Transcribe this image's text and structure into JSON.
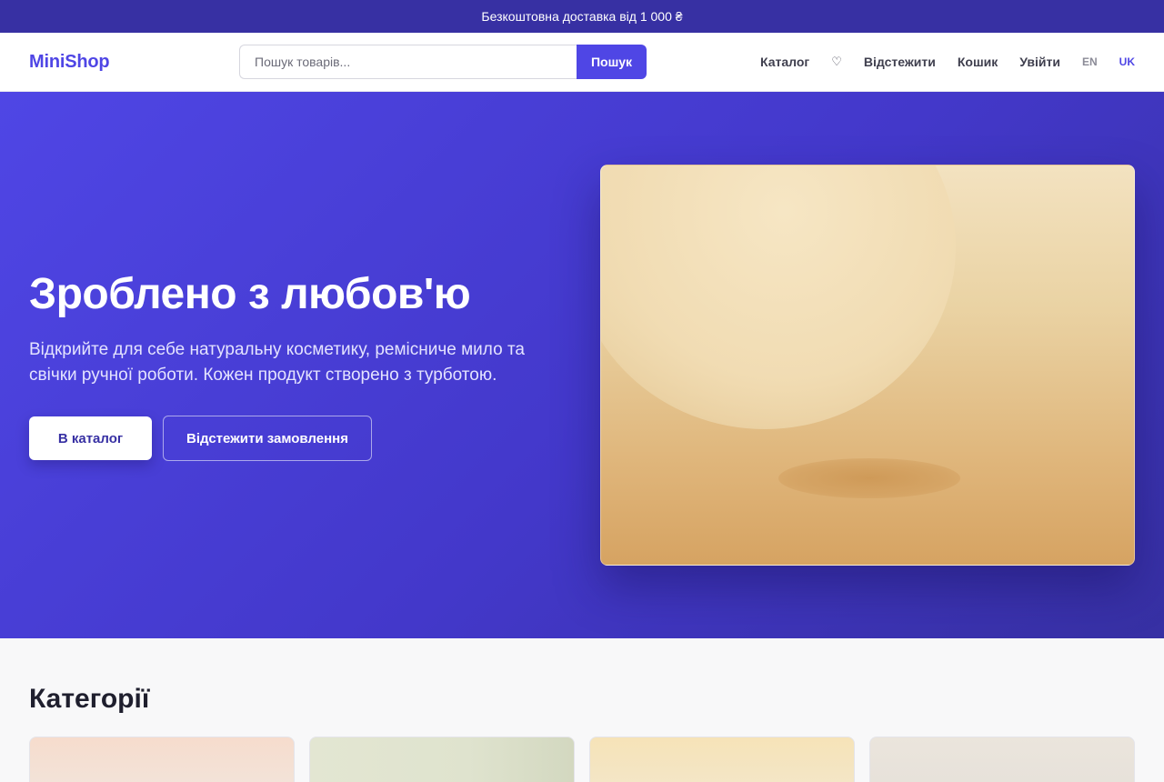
{
  "promo": {
    "text": "Безкоштовна доставка від 1 000 ₴"
  },
  "header": {
    "logo": "MiniShop",
    "search": {
      "placeholder": "Пошук товарів...",
      "value": "",
      "button_label": "Пошук"
    },
    "nav": {
      "catalog": "Каталог",
      "wishlist_icon": "♡",
      "track": "Відстежити",
      "cart": "Кошик",
      "login": "Увійти"
    },
    "languages": {
      "en": "EN",
      "uk": "UK",
      "active": "UK"
    }
  },
  "hero": {
    "title": "Зроблено з любов'ю",
    "subtitle": "Відкрийте для себе натуральну косметику, ремісниче мило та свічки ручної роботи. Кожен продукт створено з турботою.",
    "primary_button": "В каталог",
    "secondary_button": "Відстежити замовлення"
  },
  "categories": {
    "title": "Категорії"
  },
  "colors": {
    "brand": "#4f46e5",
    "promo_bg": "#3730a3",
    "hero_gradient_start": "#4f46e5",
    "hero_gradient_end": "#3730a3"
  }
}
